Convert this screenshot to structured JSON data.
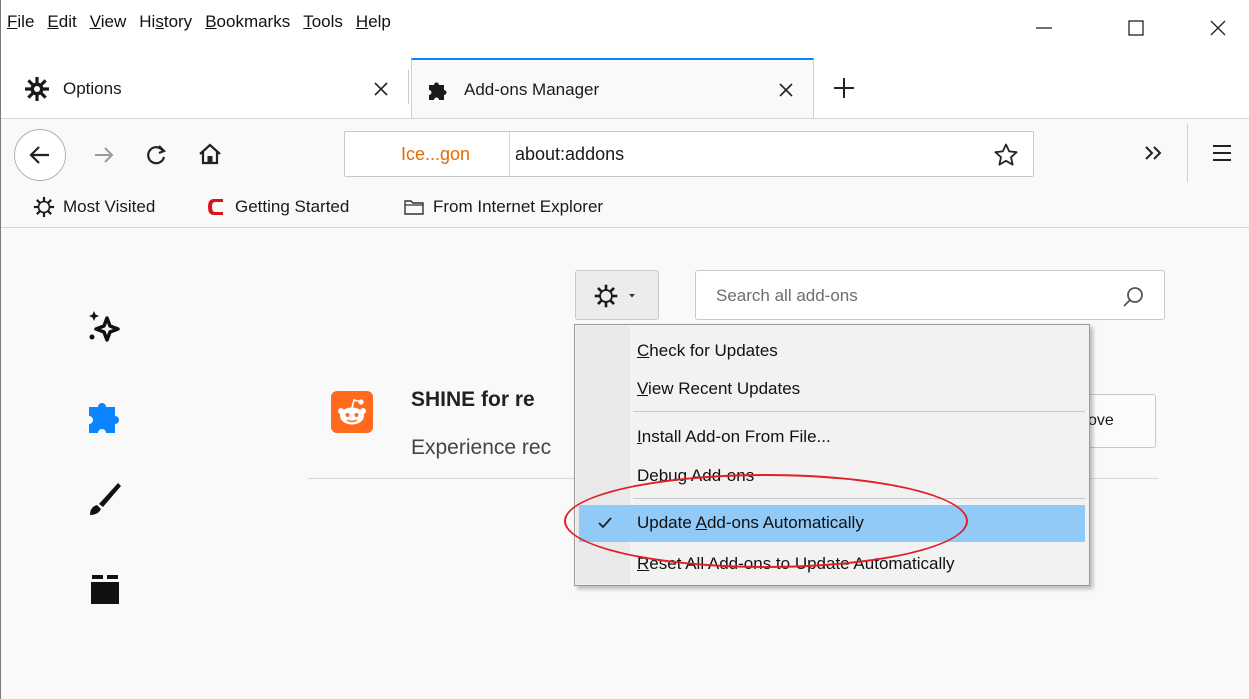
{
  "menubar": {
    "items": [
      {
        "label": "File",
        "accel": "F",
        "rest": "ile"
      },
      {
        "label": "Edit",
        "accel": "E",
        "rest": "dit"
      },
      {
        "label": "View",
        "accel": "V",
        "rest": "iew"
      },
      {
        "label": "History",
        "pre": "Hi",
        "accel": "s",
        "rest": "tory"
      },
      {
        "label": "Bookmarks",
        "accel": "B",
        "rest": "ookmarks"
      },
      {
        "label": "Tools",
        "accel": "T",
        "rest": "ools"
      },
      {
        "label": "Help",
        "accel": "H",
        "rest": "elp"
      }
    ]
  },
  "tabs": [
    {
      "title": "Options",
      "icon": "gear-icon",
      "active": false
    },
    {
      "title": "Add-ons Manager",
      "icon": "puzzle-icon",
      "active": true
    }
  ],
  "urlbar": {
    "identity": "Ice...gon",
    "url": "about:addons"
  },
  "bookmarks": [
    {
      "label": "Most Visited",
      "icon": "gear-icon"
    },
    {
      "label": "Getting Started",
      "icon": "comodo-c-icon"
    },
    {
      "label": "From Internet Explorer",
      "icon": "folder-icon"
    }
  ],
  "search": {
    "placeholder": "Search all add-ons"
  },
  "addon": {
    "title": "SHINE for re",
    "description": "Experience rec",
    "remove_label": "ove"
  },
  "dropdown": {
    "items": [
      {
        "label": "Check for Updates",
        "accel": "C",
        "rest": "heck for Updates",
        "checked": false,
        "highlighted": false
      },
      {
        "label": "View Recent Updates",
        "accel": "V",
        "rest": "iew Recent Updates",
        "checked": false,
        "highlighted": false
      },
      {
        "label": "Install Add-on From File...",
        "accel": "I",
        "rest": "nstall Add-on From File...",
        "checked": false,
        "highlighted": false
      },
      {
        "label": "Debug Add-ons",
        "pre": "Debu",
        "accel": "g",
        "rest": " Add-ons",
        "checked": false,
        "highlighted": false
      },
      {
        "label": "Update Add-ons Automatically",
        "pre": "Update ",
        "accel": "A",
        "rest": "dd-ons Automatically",
        "checked": true,
        "highlighted": true
      },
      {
        "label": "Reset All Add-ons to Update Automatically",
        "accel": "R",
        "rest": "eset All Add-ons to Update Automatically",
        "checked": false,
        "highlighted": false
      }
    ]
  },
  "colors": {
    "accent": "#0a84ff",
    "highlight": "#91c9f7",
    "annotation": "#e01f26",
    "identity": "#e66a00",
    "category_active": "#0a84ff"
  }
}
